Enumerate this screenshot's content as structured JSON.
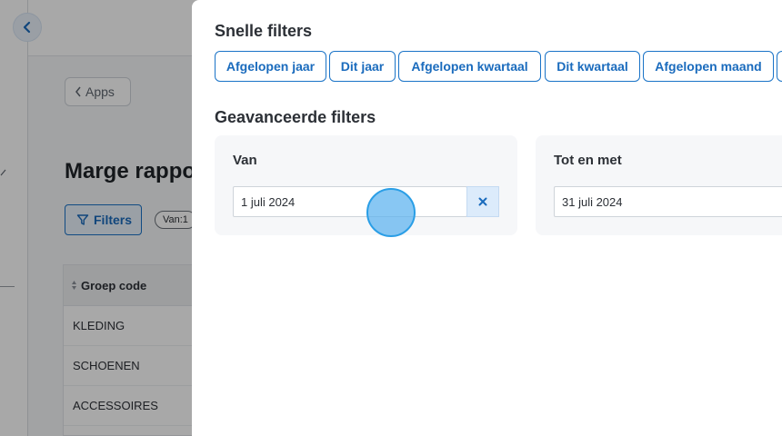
{
  "background": {
    "apps_label": "Apps",
    "page_title": "Marge rappo",
    "filters_button": "Filters",
    "filter_chip": "Van:1",
    "table": {
      "column_header": "Groep code",
      "rows": [
        "KLEDING",
        "SCHOENEN",
        "ACCESSOIRES"
      ]
    }
  },
  "quick_filters": {
    "title": "Snelle filters",
    "options": [
      "Afgelopen jaar",
      "Dit jaar",
      "Afgelopen kwartaal",
      "Dit kwartaal",
      "Afgelopen maand"
    ]
  },
  "advanced_filters": {
    "title": "Geavanceerde filters",
    "from": {
      "label": "Van",
      "value": "1 juli 2024"
    },
    "to": {
      "label": "Tot en met",
      "value": "31 juli 2024"
    }
  },
  "colors": {
    "accent": "#1a73c7",
    "accent_light": "#dcebfb",
    "card_bg": "#f6f7f9",
    "click_indicator": "#5ab2ee"
  },
  "icons": [
    "back-arrow-icon",
    "chevron-left-icon",
    "filter-icon",
    "sort-icon",
    "clear-x-icon"
  ]
}
